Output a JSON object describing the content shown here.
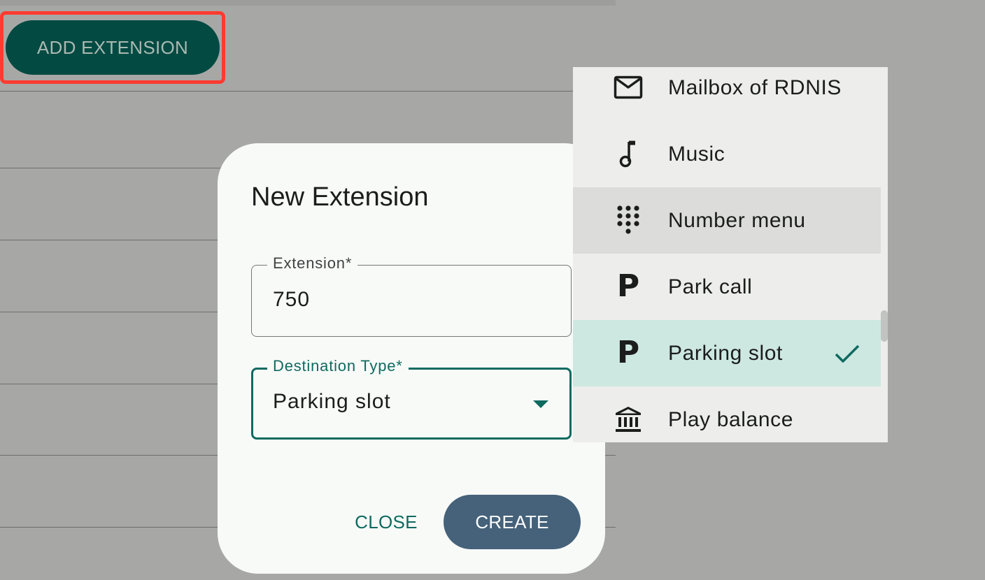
{
  "background": {
    "add_button_label": "ADD EXTENSION"
  },
  "dialog": {
    "title": "New Extension",
    "extension_field": {
      "label": "Extension*",
      "value": "750"
    },
    "destination_field": {
      "label": "Destination Type*",
      "value": "Parking slot"
    },
    "close_label": "CLOSE",
    "create_label": "CREATE"
  },
  "menu": {
    "items": [
      {
        "label": "Mailbox of RDNIS",
        "icon": "mail-icon"
      },
      {
        "label": "Music",
        "icon": "music-note-icon"
      },
      {
        "label": "Number menu",
        "icon": "dialpad-icon",
        "state": "hover"
      },
      {
        "label": "Park call",
        "icon": "parking-icon"
      },
      {
        "label": "Parking slot",
        "icon": "parking-icon",
        "state": "selected"
      },
      {
        "label": "Play balance",
        "icon": "bank-icon"
      }
    ]
  },
  "colors": {
    "accent": "#0f6a60",
    "add_button": "#034a42",
    "create_button": "#45627a",
    "selected_item": "#cde8e1",
    "highlight_box": "#ff3b30"
  }
}
